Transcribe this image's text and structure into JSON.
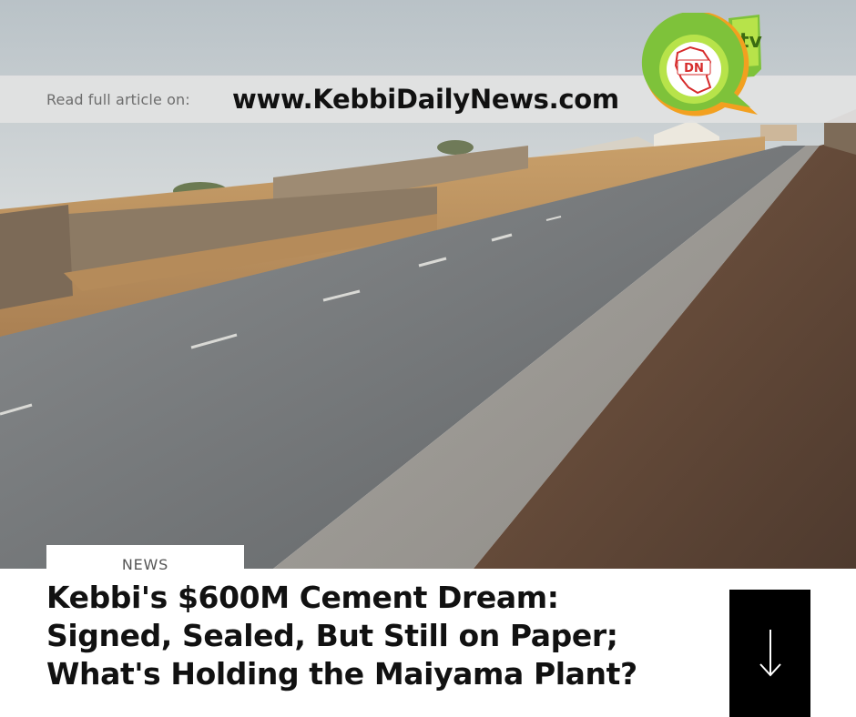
{
  "banner": {
    "lead_text": "Read full article on:",
    "url_text": "www.KebbiDailyNews.com"
  },
  "logo": {
    "mark_text": "DN",
    "tv_text": "tv",
    "colors": {
      "green": "#7ec23a",
      "lime": "#b7e34a",
      "orange": "#f2a020",
      "red": "#d62b2b"
    }
  },
  "article": {
    "category": "NEWS",
    "headline_lines": [
      "Kebbi's $600M Cement Dream:",
      "Signed, Sealed, But Still on Paper;",
      "What's Holding the Maiyama Plant?"
    ]
  },
  "cta": {
    "icon": "arrow-down-icon"
  },
  "colors": {
    "banner_bg": "#e2e2e2",
    "headline": "#111111",
    "button_bg": "#000000"
  }
}
